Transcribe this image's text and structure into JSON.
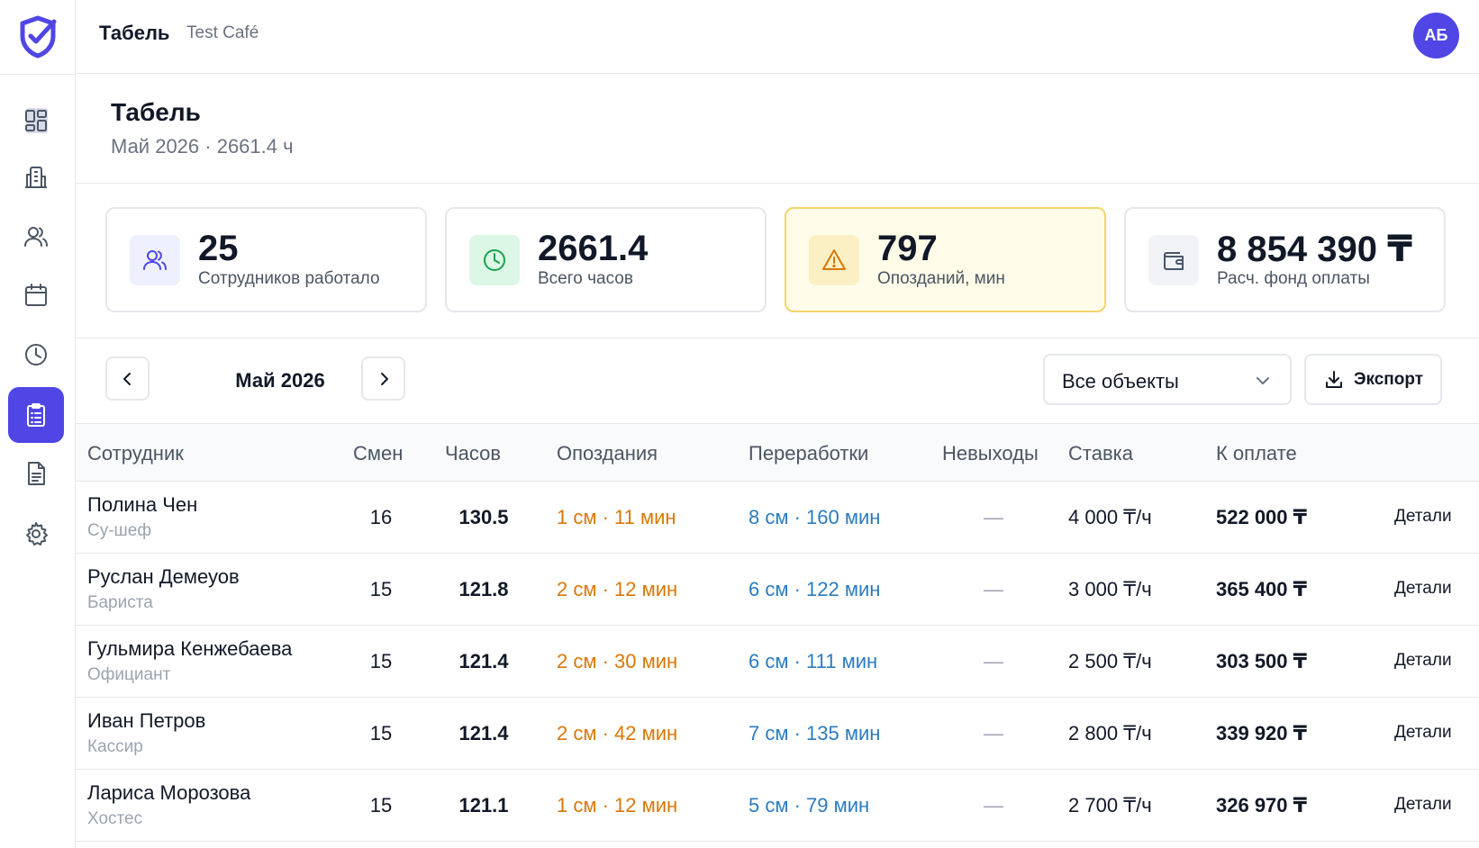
{
  "header": {
    "title": "Табель",
    "org": "Test Café",
    "avatar_initials": "АБ"
  },
  "sidebar": {
    "items": [
      {
        "icon": "dashboard-icon",
        "active": false
      },
      {
        "icon": "building-icon",
        "active": false
      },
      {
        "icon": "users-icon",
        "active": false
      },
      {
        "icon": "calendar-icon",
        "active": false
      },
      {
        "icon": "clock-icon",
        "active": false
      },
      {
        "icon": "clipboard-icon",
        "active": true
      },
      {
        "icon": "document-icon",
        "active": false
      },
      {
        "icon": "settings-icon",
        "active": false
      }
    ]
  },
  "page": {
    "title": "Табель",
    "subtitle": "Май 2026 · 2661.4 ч"
  },
  "stats": [
    {
      "value": "25",
      "label": "Сотрудников работало",
      "icon": "users-icon",
      "color": "#4f46e5"
    },
    {
      "value": "2661.4",
      "label": "Всего часов",
      "icon": "clock-icon",
      "color": "#16a34a"
    },
    {
      "value": "797",
      "label": "Опозданий, мин",
      "icon": "warning-icon",
      "color": "#d97706"
    },
    {
      "value": "8 854 390 ₸",
      "label": "Расч. фонд оплаты",
      "icon": "wallet-icon",
      "color": "#475569"
    }
  ],
  "toolbar": {
    "month": "Май 2026",
    "filter_value": "Все объекты",
    "export_label": "Экспорт"
  },
  "table": {
    "columns": [
      "Сотрудник",
      "Смен",
      "Часов",
      "Опоздания",
      "Переработки",
      "Невыходы",
      "Ставка",
      "К оплате"
    ],
    "rows": [
      {
        "name": "Полина Чен",
        "role": "Су-шеф",
        "shifts": "16",
        "hours": "130.5",
        "late": "1 см · 11 мин",
        "overtime": "8 см · 160 мин",
        "absent": "—",
        "rate": "4 000 ₸/ч",
        "pay": "522 000 ₸",
        "action": "Детали"
      },
      {
        "name": "Руслан Демеуов",
        "role": "Бариста",
        "shifts": "15",
        "hours": "121.8",
        "late": "2 см · 12 мин",
        "overtime": "6 см · 122 мин",
        "absent": "—",
        "rate": "3 000 ₸/ч",
        "pay": "365 400 ₸",
        "action": "Детали"
      },
      {
        "name": "Гульмира Кенжебаева",
        "role": "Официант",
        "shifts": "15",
        "hours": "121.4",
        "late": "2 см · 30 мин",
        "overtime": "6 см · 111 мин",
        "absent": "—",
        "rate": "2 500 ₸/ч",
        "pay": "303 500 ₸",
        "action": "Детали"
      },
      {
        "name": "Иван Петров",
        "role": "Кассир",
        "shifts": "15",
        "hours": "121.4",
        "late": "2 см · 42 мин",
        "overtime": "7 см · 135 мин",
        "absent": "—",
        "rate": "2 800 ₸/ч",
        "pay": "339 920 ₸",
        "action": "Детали"
      },
      {
        "name": "Лариса Морозова",
        "role": "Хостес",
        "shifts": "15",
        "hours": "121.1",
        "late": "1 см · 12 мин",
        "overtime": "5 см · 79 мин",
        "absent": "—",
        "rate": "2 700 ₸/ч",
        "pay": "326 970 ₸",
        "action": "Детали"
      }
    ]
  },
  "colors": {
    "accent": "#4f46e5",
    "late": "#d97706",
    "overtime": "#2b7bc0",
    "warn_bg": "#fefbe8"
  }
}
